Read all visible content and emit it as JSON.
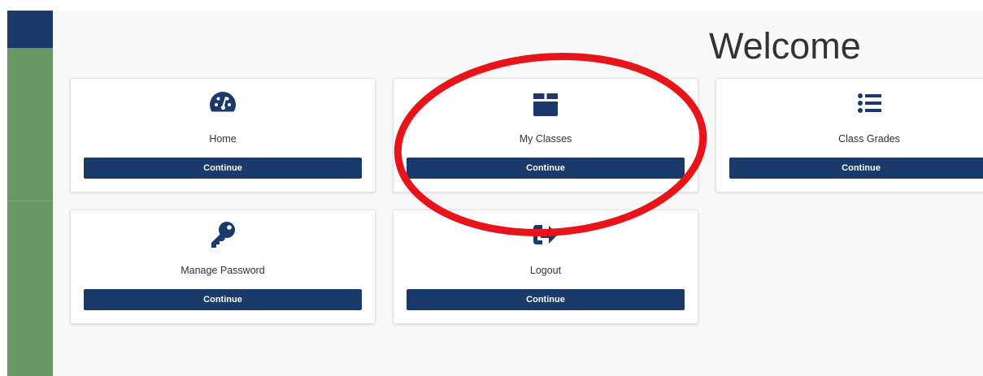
{
  "page": {
    "heading": "Welcome"
  },
  "cards": [
    {
      "label": "Home",
      "icon": "dashboard-icon",
      "button": "Continue"
    },
    {
      "label": "My Classes",
      "icon": "box-icon",
      "button": "Continue"
    },
    {
      "label": "Class Grades",
      "icon": "list-icon",
      "button": "Continue"
    },
    {
      "label": "Manage Password",
      "icon": "key-icon",
      "button": "Continue"
    },
    {
      "label": "Logout",
      "icon": "sign-out-icon",
      "button": "Continue"
    }
  ],
  "colors": {
    "brand_navy": "#1a3a6b",
    "sidebar_green": "#6a9766",
    "annotation_red": "#e8141a"
  },
  "annotation": {
    "shape": "ellipse",
    "target": "My Classes card"
  }
}
